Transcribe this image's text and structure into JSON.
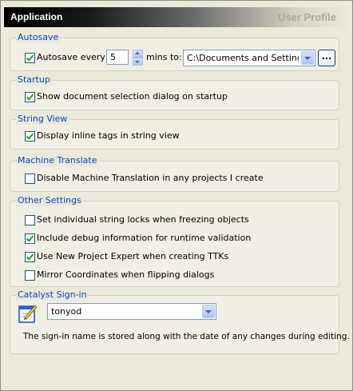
{
  "header": {
    "title": "Application",
    "right_label": "User Profile"
  },
  "autosave": {
    "group_title": "Autosave",
    "checkbox_label": "Autosave every",
    "checked": true,
    "minutes_value": "5",
    "mins_to_label": "mins to:",
    "path_value": "C:\\Documents and Settings\\A",
    "browse_label": "..."
  },
  "startup": {
    "group_title": "Startup",
    "checkbox_label": "Show document selection dialog on startup",
    "checked": true
  },
  "string_view": {
    "group_title": "String View",
    "checkbox_label": "Display inline tags in string view",
    "checked": true
  },
  "machine_translate": {
    "group_title": "Machine Translate",
    "checkbox_label": "Disable Machine Translation in any projects I create",
    "checked": false
  },
  "other_settings": {
    "group_title": "Other Settings",
    "items": [
      {
        "label": "Set individual string locks when freezing objects",
        "checked": false
      },
      {
        "label": "Include debug information for runtime validation",
        "checked": true
      },
      {
        "label": "Use New Project Expert when creating TTKs",
        "checked": true
      },
      {
        "label": "Mirror Coordinates when flipping dialogs",
        "checked": false
      }
    ]
  },
  "catalyst_signin": {
    "group_title": "Catalyst Sign-in",
    "username": "tonyod",
    "note": "The sign-in name is stored along with the date of any changes during editing."
  },
  "colors": {
    "group_title": "#0046d5",
    "header_text": "#ffffff",
    "checkmark": "#21a121",
    "background": "#ece9d8"
  }
}
